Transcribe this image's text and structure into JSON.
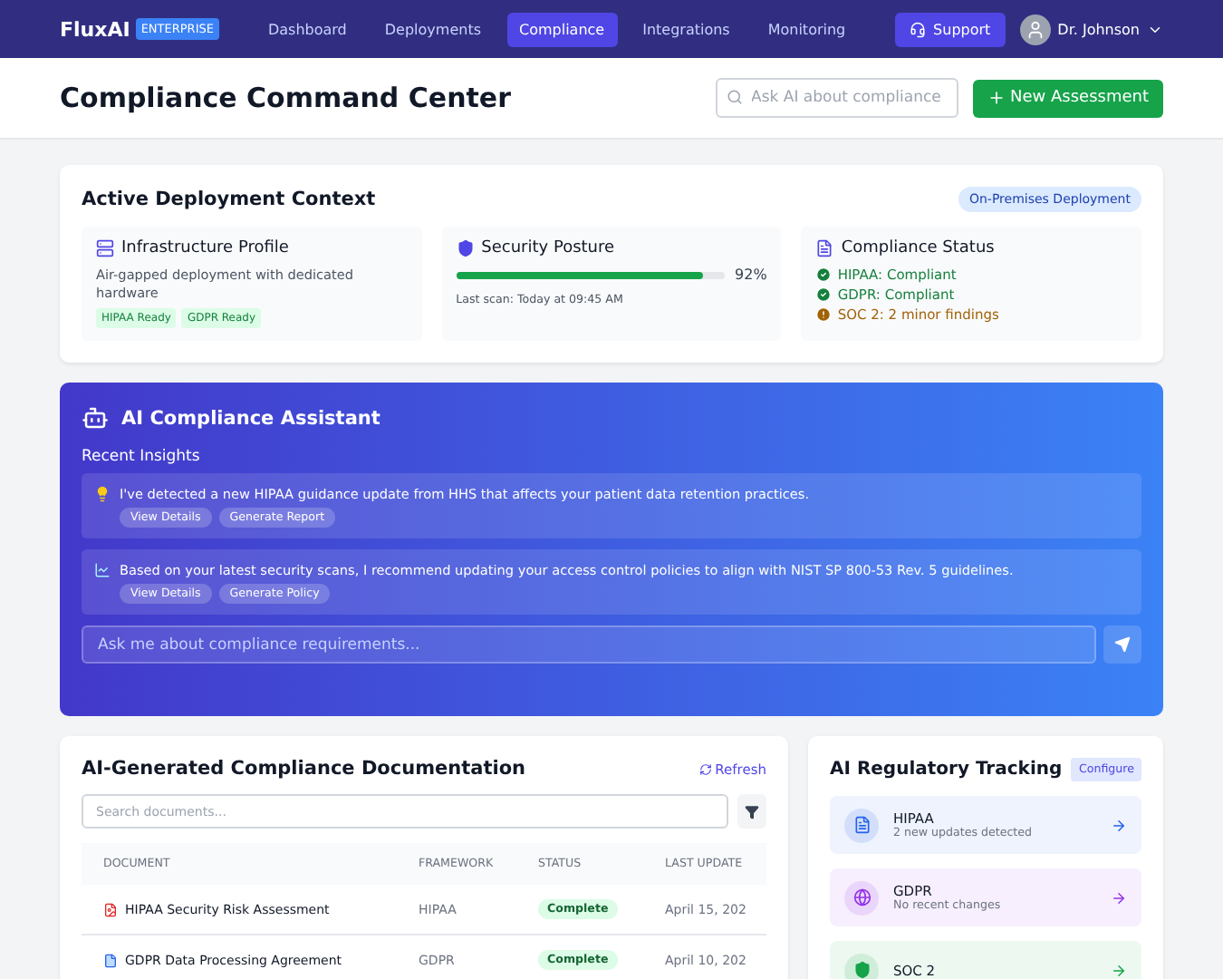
{
  "nav": {
    "brand": "FluxAI",
    "edition": "ENTERPRISE",
    "links": [
      {
        "label": "Dashboard",
        "selected": false
      },
      {
        "label": "Deployments",
        "selected": false
      },
      {
        "label": "Compliance",
        "selected": true
      },
      {
        "label": "Integrations",
        "selected": false
      },
      {
        "label": "Monitoring",
        "selected": false
      }
    ],
    "support": "Support",
    "user": "Dr. Johnson"
  },
  "header": {
    "title": "Compliance Command Center",
    "search_placeholder": "Ask AI about compliance",
    "new_button": "New Assessment"
  },
  "context": {
    "title": "Active Deployment Context",
    "badge": "On-Premises Deployment",
    "infrastructure": {
      "title": "Infrastructure Profile",
      "description": "Air-gapped deployment with dedicated hardware",
      "tags": [
        "HIPAA Ready",
        "GDPR Ready"
      ]
    },
    "security": {
      "title": "Security Posture",
      "level": 0.92,
      "reading": "92%",
      "last_scan": "Last scan: Today at 09:45 AM"
    },
    "compliance": {
      "title": "Compliance Status",
      "items": [
        {
          "kind": "ok",
          "text": "HIPAA: Compliant"
        },
        {
          "kind": "ok",
          "text": "GDPR: Compliant"
        },
        {
          "kind": "warning",
          "text": "SOC 2: 2 minor findings"
        }
      ]
    }
  },
  "assistant": {
    "title": "AI Compliance Assistant",
    "subtitle": "Recent Insights",
    "insights": [
      {
        "kind": "idea",
        "text": "I've detected a new HIPAA guidance update from HHS that affects your patient data retention practices.",
        "actions": [
          "View Details",
          "Generate Report"
        ]
      },
      {
        "kind": "trend",
        "text": "Based on your latest security scans, I recommend updating your access control policies to align with NIST SP 800-53 Rev. 5 guidelines.",
        "actions": [
          "View Details",
          "Generate Policy"
        ]
      }
    ],
    "input_placeholder": "Ask me about compliance requirements..."
  },
  "documents": {
    "title": "AI-Generated Compliance Documentation",
    "refresh": "Refresh",
    "search_placeholder": "Search documents...",
    "columns": [
      "DOCUMENT",
      "FRAMEWORK",
      "STATUS",
      "LAST UPDATE"
    ],
    "rows": [
      {
        "kind": "pdf",
        "name": "HIPAA Security Risk Assessment",
        "framework": "HIPAA",
        "status": "Complete",
        "date": "April 15, 202"
      },
      {
        "kind": "doc",
        "name": "GDPR Data Processing Agreement",
        "framework": "GDPR",
        "status": "Complete",
        "date": "April 10, 202"
      }
    ]
  },
  "tracking": {
    "title": "AI Regulatory Tracking",
    "configure": "Configure",
    "items": [
      {
        "kind": "file",
        "name": "HIPAA",
        "detail": "2 new updates detected",
        "color": "#2563eb"
      },
      {
        "kind": "globe",
        "name": "GDPR",
        "detail": "No recent changes",
        "color": "#9333ea"
      },
      {
        "kind": "shield",
        "name": "SOC 2",
        "color": "#16a34a"
      }
    ]
  }
}
